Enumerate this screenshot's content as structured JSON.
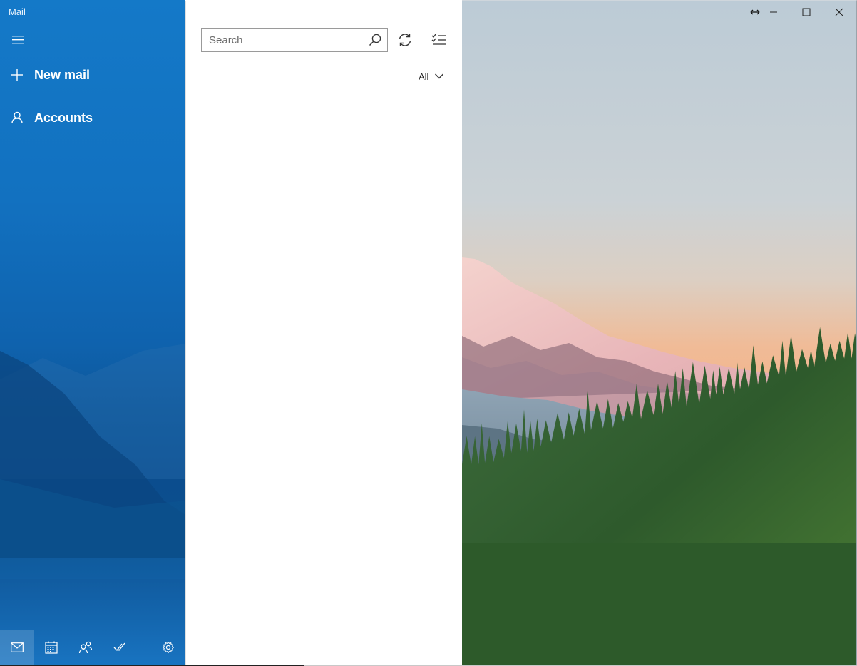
{
  "app": {
    "title": "Mail"
  },
  "nav": {
    "menu_icon": "hamburger-menu-icon",
    "new_mail_label": "New mail",
    "accounts_label": "Accounts",
    "bottom_buttons": [
      {
        "name": "mail",
        "icon": "mail-icon",
        "active": true
      },
      {
        "name": "calendar",
        "icon": "calendar-icon"
      },
      {
        "name": "people",
        "icon": "people-icon"
      },
      {
        "name": "todo",
        "icon": "checkmark-todo-icon"
      },
      {
        "name": "settings",
        "icon": "gear-icon"
      }
    ]
  },
  "list": {
    "search_placeholder": "Search",
    "filter_label": "All",
    "sync_icon": "sync-icon",
    "select_icon": "select-mode-icon"
  },
  "window": {
    "controls": [
      "resize",
      "minimize",
      "maximize",
      "close"
    ]
  },
  "colors": {
    "accent": "#1271c0",
    "nav_dark": "#0b4d8e",
    "sky_top": "#bccbd6",
    "sky_bottom": "#f1b58d",
    "forest": "#2f5f2d"
  }
}
